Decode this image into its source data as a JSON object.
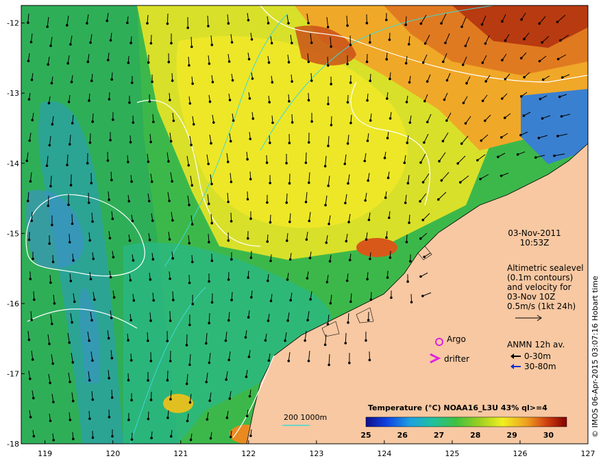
{
  "map": {
    "lat_ticks": [
      "-12",
      "-13",
      "-14",
      "-15",
      "-16",
      "-17",
      "-18"
    ],
    "lon_ticks": [
      "119",
      "120",
      "121",
      "122",
      "123",
      "124",
      "125",
      "126",
      "127"
    ],
    "lon_range": [
      118.65,
      127
    ],
    "lat_range": [
      -18,
      -11.75
    ]
  },
  "annotations": {
    "date": "03-Nov-2011",
    "time": "10:53Z",
    "altimetry_lines": [
      "Altimetric sealevel",
      "(0.1m contours)",
      "and velocity for",
      "03-Nov 10Z",
      "0.5m/s (1kt 24h)"
    ],
    "argo_label": "Argo",
    "drifter_label": "drifter",
    "anmn_title": "ANMN 12h av.",
    "anmn_shallow": "0-30m",
    "anmn_deep": "30-80m",
    "isobath_label": "200  1000m"
  },
  "colorbar": {
    "title": "Temperature (°C) NOAA16_L3U 43% ql>=4",
    "ticks": [
      "25",
      "26",
      "27",
      "28",
      "29",
      "30"
    ],
    "range": [
      25,
      30.5
    ]
  },
  "credit": "© IMOS 06-Apr-2015 03:07:16 Hobart time",
  "colors": {
    "land": "#f7c8a2",
    "argo_marker": "#e020e0",
    "drifter_marker": "#e020e0",
    "anmn_shallow": "#000000",
    "anmn_deep": "#1030d0",
    "isobath_200": "#40d8d8",
    "sealevel_contour": "#ffffff"
  }
}
